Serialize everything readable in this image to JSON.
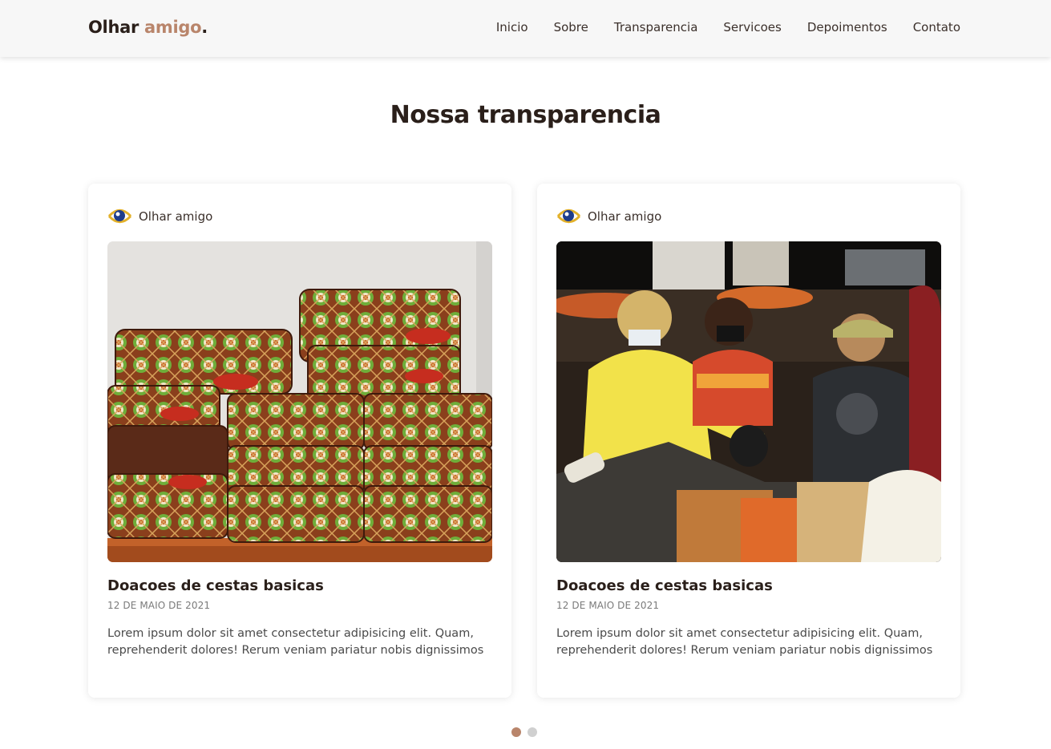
{
  "header": {
    "logo_main": "Olhar",
    "logo_accent": "amigo",
    "logo_dot": ".",
    "nav": [
      "Inicio",
      "Sobre",
      "Transparencia",
      "Servicoes",
      "Depoimentos",
      "Contato"
    ]
  },
  "section": {
    "title": "Nossa transparencia"
  },
  "cards": [
    {
      "author": "Olhar amigo",
      "image_description": "stacked bags",
      "title": "Doacoes de cestas basicas",
      "date": "12 DE MAIO DE 2021",
      "text": "Lorem ipsum dolor sit amet consectetur adipisicing elit. Quam, reprehenderit dolores! Rerum veniam pariatur nobis dignissimos"
    },
    {
      "author": "Olhar amigo",
      "image_description": "night distribution",
      "title": "Doacoes de cestas basicas",
      "date": "12 DE MAIO DE 2021",
      "text": "Lorem ipsum dolor sit amet consectetur adipisicing elit. Quam, reprehenderit dolores! Rerum veniam pariatur nobis dignissimos"
    }
  ],
  "carousel": {
    "page_count": 2,
    "active_index": 0
  },
  "colors": {
    "accent": "#b9856b",
    "text_dark": "#2a1f1a",
    "header_bg": "#f7f7f7",
    "dot_inactive": "#d0d0d0"
  }
}
